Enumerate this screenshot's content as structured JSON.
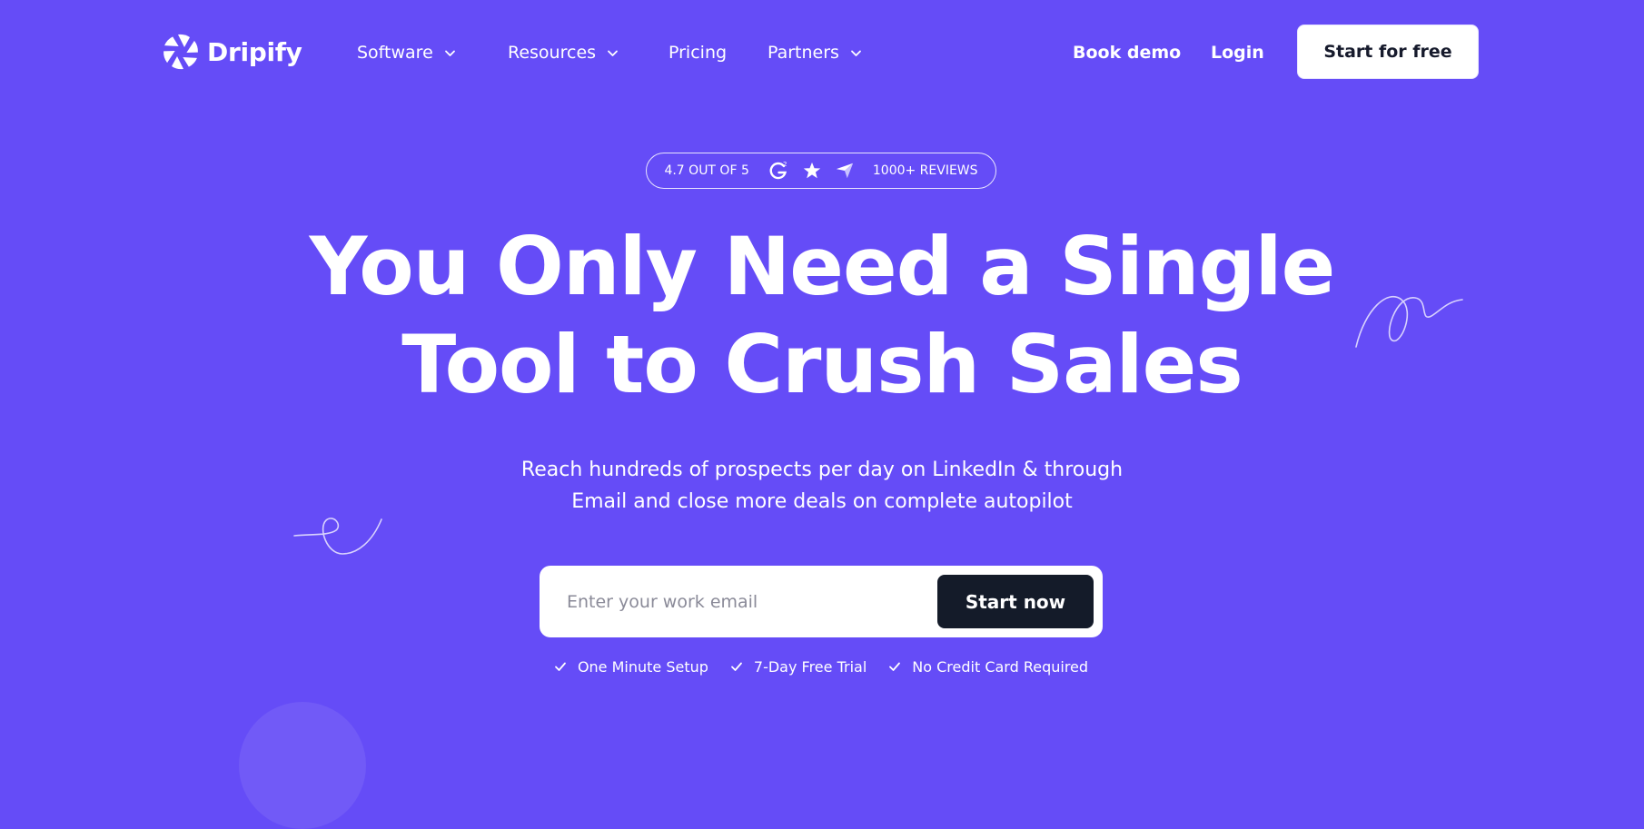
{
  "brand": {
    "name": "Dripify",
    "logo_icon": "aperture-logo-icon"
  },
  "nav": {
    "items": [
      {
        "label": "Software",
        "has_dropdown": true
      },
      {
        "label": "Resources",
        "has_dropdown": true
      },
      {
        "label": "Pricing",
        "has_dropdown": false
      },
      {
        "label": "Partners",
        "has_dropdown": true
      }
    ],
    "book_demo": "Book demo",
    "login": "Login",
    "cta": "Start for free"
  },
  "rating": {
    "score_text": "4.7 OUT OF 5",
    "icons": [
      "g2-icon",
      "star-icon",
      "capterra-icon"
    ],
    "reviews_text": "1000+ REVIEWS"
  },
  "hero": {
    "headline_line1": "You Only Need a Single",
    "headline_line2": "Tool to Crush Sales",
    "sub_line1": "Reach hundreds of prospects per day on LinkedIn & through",
    "sub_line2": "Email and close more deals on complete autopilot"
  },
  "form": {
    "email_placeholder": "Enter your work email",
    "email_value": "",
    "submit": "Start now"
  },
  "benefits": [
    "One Minute Setup",
    "7-Day Free Trial",
    "No Credit Card Required"
  ],
  "colors": {
    "background": "#654cf7",
    "primary_button": "#141b29",
    "text_light": "#ffffff",
    "text_dark": "#161a2c"
  }
}
